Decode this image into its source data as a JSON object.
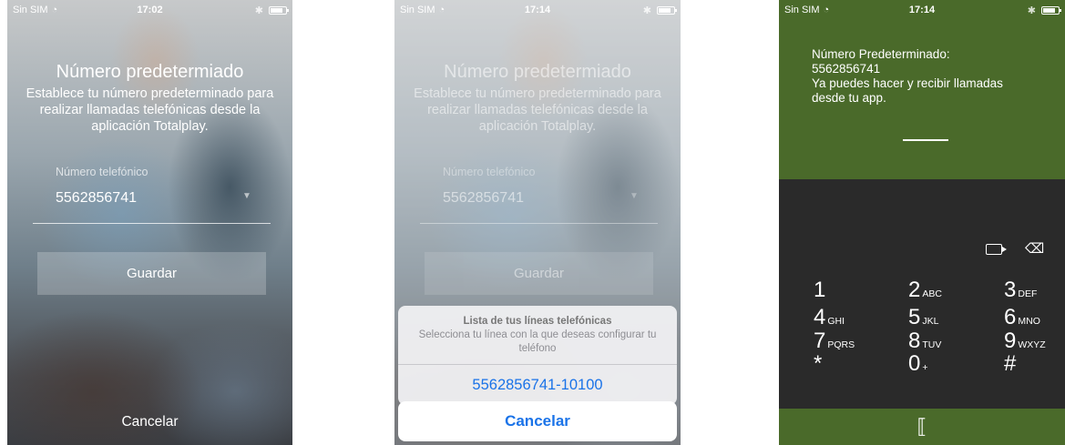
{
  "screens": [
    {
      "status": {
        "carrier": "Sin SIM",
        "time": "17:02"
      },
      "title": "Número predetermiado",
      "subtitle": "Establece tu número predeterminado para realizar llamadas telefónicas desde la aplicación Totalplay.",
      "field_label": "Número telefónico",
      "field_value": "5562856741",
      "save_label": "Guardar",
      "cancel_label": "Cancelar"
    },
    {
      "status": {
        "carrier": "Sin SIM",
        "time": "17:14"
      },
      "title": "Número predetermiado",
      "subtitle": "Establece tu número predeterminado para realizar llamadas telefónicas desde la aplicación Totalplay.",
      "field_label": "Número telefónico",
      "field_value": "5562856741",
      "save_label": "Guardar",
      "sheet": {
        "title": "Lista de tus líneas telefónicas",
        "message": "Selecciona tu línea con la que deseas configurar tu teléfono",
        "option": "5562856741-10100",
        "cancel_label": "Cancelar"
      }
    },
    {
      "status": {
        "carrier": "Sin SIM",
        "time": "17:14"
      },
      "message_line1": "Número Predeterminado:",
      "message_line2": "5562856741",
      "message_line3": "Ya puedes hacer y recibir llamadas",
      "message_line4": "desde tu app.",
      "keypad": [
        {
          "num": "1",
          "letters": ""
        },
        {
          "num": "2",
          "letters": "ABC"
        },
        {
          "num": "3",
          "letters": "DEF"
        },
        {
          "num": "4",
          "letters": "GHI"
        },
        {
          "num": "5",
          "letters": "JKL"
        },
        {
          "num": "6",
          "letters": "MNO"
        },
        {
          "num": "7",
          "letters": "PQRS"
        },
        {
          "num": "8",
          "letters": "TUV"
        },
        {
          "num": "9",
          "letters": "WXYZ"
        },
        {
          "num": "*",
          "letters": ""
        },
        {
          "num": "0",
          "letters": "+"
        },
        {
          "num": "#",
          "letters": ""
        }
      ]
    }
  ],
  "icons": {
    "wifi": "wifi-icon",
    "bluetooth": "bluetooth-icon",
    "battery": "battery-icon",
    "dropdown": "chevron-down-icon",
    "video": "video-icon",
    "backspace": "backspace-icon",
    "call": "call-icon"
  },
  "colors": {
    "green_bar": "#4a6a2a",
    "dialer_bg": "#2a2a2a",
    "ios_blue": "#1a73e8"
  }
}
